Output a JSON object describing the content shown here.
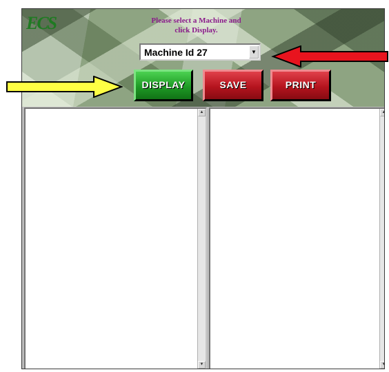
{
  "header": {
    "logo_text": "ECS",
    "prompt_line1": "Please select a Machine and",
    "prompt_line2": "click Display."
  },
  "machine_select": {
    "selected_value": "Machine Id 27"
  },
  "buttons": {
    "display_label": "DISPLAY",
    "save_label": "SAVE",
    "print_label": "PRINT"
  },
  "annotations": {
    "yellow_arrow_color": "#ffff44",
    "red_arrow_color": "#e8141e"
  },
  "colors": {
    "display_button": "#1e9a25",
    "save_print_buttons": "#b5141e",
    "prompt_text": "#8a1a8a",
    "logo": "#1f7a22"
  }
}
